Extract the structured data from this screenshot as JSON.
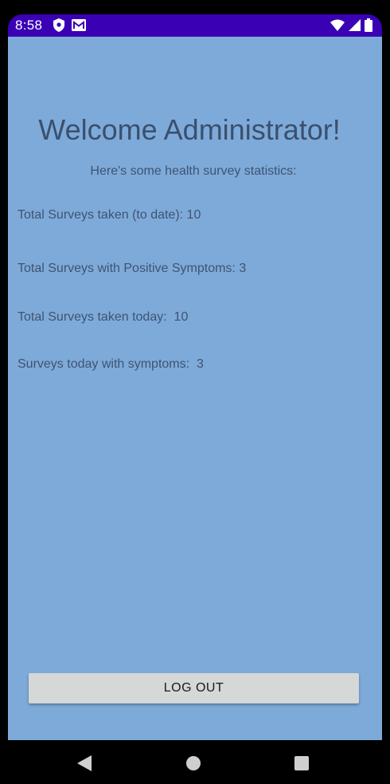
{
  "status_bar": {
    "time": "8:58",
    "icons_left": [
      "shield-icon",
      "gmail-icon"
    ],
    "icons_right": [
      "wifi-icon",
      "signal-icon",
      "battery-icon"
    ],
    "color": "#3a00b4"
  },
  "main": {
    "background_color": "#7eaad9",
    "title": "Welcome Administrator!",
    "subtitle": "Here's some health survey statistics:",
    "stats": [
      "Total Surveys taken (to date): 10",
      "Total Surveys with Positive Symptoms: 3",
      "Total Surveys taken today:  10",
      "Surveys today with symptoms:  3"
    ],
    "logout_label": "LOG OUT"
  },
  "nav_bar": {
    "icons": [
      "back-icon",
      "home-icon",
      "recents-icon"
    ]
  }
}
